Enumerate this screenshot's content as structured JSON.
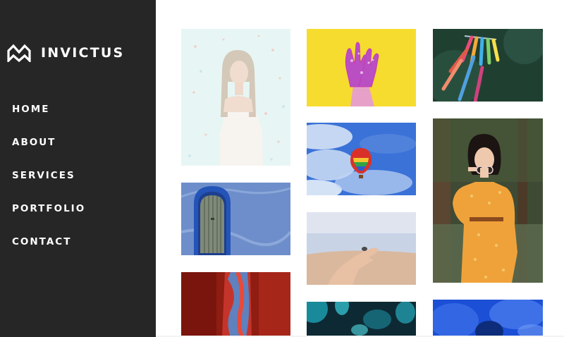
{
  "brand": {
    "name": "INVICTUS",
    "logo_icon": "invictus-logo-icon"
  },
  "nav": {
    "items": [
      {
        "label": "HOME"
      },
      {
        "label": "ABOUT"
      },
      {
        "label": "SERVICES"
      },
      {
        "label": "PORTFOLIO"
      },
      {
        "label": "CONTACT"
      }
    ]
  },
  "gallery": {
    "items": [
      {
        "subject": "woman in confetti"
      },
      {
        "subject": "blue door"
      },
      {
        "subject": "red abstract"
      },
      {
        "subject": "painted hands on yellow"
      },
      {
        "subject": "hot air balloon in blue sky"
      },
      {
        "subject": "open hand at beach"
      },
      {
        "subject": "teal lights"
      },
      {
        "subject": "colorful clothes pins"
      },
      {
        "subject": "woman in orange dress"
      },
      {
        "subject": "blue smoke"
      }
    ]
  },
  "colors": {
    "sidebar": "#262626",
    "text": "#ffffff",
    "background": "#ffffff"
  }
}
